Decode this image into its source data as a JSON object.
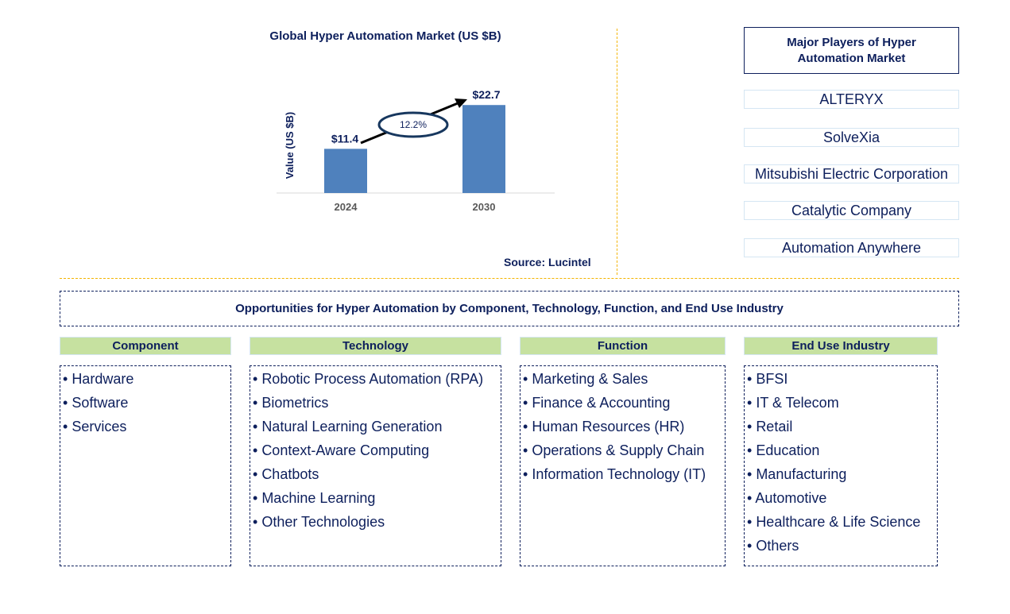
{
  "chart_data": {
    "type": "bar",
    "title": "Global Hyper Automation Market (US $B)",
    "xlabel": "",
    "ylabel": "Value (US $B)",
    "categories": [
      "2024",
      "2030"
    ],
    "values": [
      11.4,
      22.7
    ],
    "data_labels": [
      "$11.4",
      "$22.7"
    ],
    "ylim": [
      0,
      25
    ],
    "grid": false,
    "annotation": {
      "type": "cagr-arrow",
      "label": "12.2%"
    },
    "bar_color": "#4f81bd"
  },
  "source": "Source: Lucintel",
  "players": {
    "header": "Major Players of Hyper Automation Market",
    "items": [
      "ALTERYX",
      "SolveXia",
      "Mitsubishi Electric Corporation",
      "Catalytic Company",
      "Automation Anywhere"
    ]
  },
  "opportunities": {
    "title": "Opportunities for Hyper Automation by Component, Technology, Function, and End Use Industry",
    "categories": [
      {
        "name": "Component",
        "items": [
          "Hardware",
          "Software",
          "Services"
        ]
      },
      {
        "name": "Technology",
        "items": [
          "Robotic Process Automation (RPA)",
          "Biometrics",
          "Natural Learning Generation",
          "Context-Aware Computing",
          "Chatbots",
          "Machine Learning",
          "Other Technologies"
        ]
      },
      {
        "name": "Function",
        "items": [
          "Marketing & Sales",
          "Finance & Accounting",
          "Human Resources (HR)",
          "Operations & Supply Chain",
          "Information Technology (IT)"
        ]
      },
      {
        "name": "End Use Industry",
        "items": [
          "BFSI",
          "IT & Telecom",
          "Retail",
          "Education",
          "Manufacturing",
          "Automotive",
          "Healthcare & Life Science",
          "Others"
        ]
      }
    ]
  },
  "colors": {
    "text": "#0d1f5c",
    "bar": "#4f81bd",
    "header_fill": "#c6e1a0",
    "divider": "#f4b400"
  }
}
